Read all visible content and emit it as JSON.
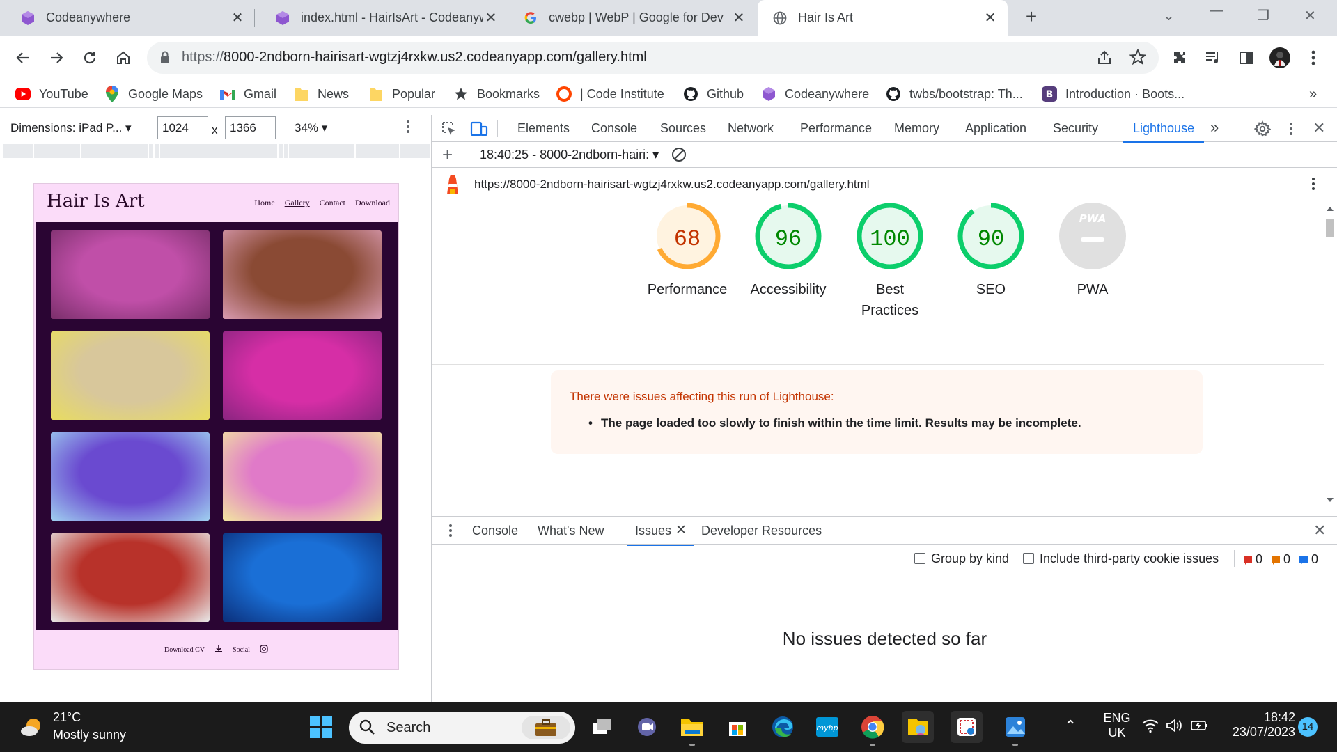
{
  "browser": {
    "tabs": [
      {
        "title": "Codeanywhere",
        "icon": "codeanywhere-icon"
      },
      {
        "title": "index.html - HairIsArt - Codeanyw",
        "icon": "codeanywhere-icon"
      },
      {
        "title": "cwebp  |  WebP  |  Google for Dev",
        "icon": "google-icon"
      },
      {
        "title": "Hair Is Art",
        "icon": "globe-icon",
        "active": true
      }
    ],
    "url": "https://8000-2ndborn-hairisart-wgtzj4rxkw.us2.codeanyapp.com/gallery.html",
    "url_prefix": "https://",
    "url_rest": "8000-2ndborn-hairisart-wgtzj4rxkw.us2.codeanyapp.com/gallery.html",
    "bookmarks": [
      {
        "label": "YouTube",
        "icon": "youtube-icon"
      },
      {
        "label": "Google Maps",
        "icon": "maps-pin-icon"
      },
      {
        "label": "Gmail",
        "icon": "gmail-icon"
      },
      {
        "label": "News",
        "icon": "folder-icon"
      },
      {
        "label": "Popular",
        "icon": "folder-icon"
      },
      {
        "label": "Bookmarks",
        "icon": "star-icon"
      },
      {
        "label": "| Code Institute",
        "icon": "code-institute-icon"
      },
      {
        "label": "Github",
        "icon": "github-icon"
      },
      {
        "label": "Codeanywhere",
        "icon": "codeanywhere-icon"
      },
      {
        "label": "twbs/bootstrap: Th...",
        "icon": "github-icon"
      },
      {
        "label": "Introduction · Boots...",
        "icon": "bootstrap-icon"
      }
    ],
    "bookmarks_overflow": "»"
  },
  "device_toolbar": {
    "dimensions_label": "Dimensions: iPad P...",
    "width": "1024",
    "times": "x",
    "height": "1366",
    "zoom": "34%"
  },
  "simulated_page": {
    "logo": "Hair Is Art",
    "nav": [
      "Home",
      "Gallery",
      "Contact",
      "Download"
    ],
    "footer_download": "Download CV",
    "footer_social": "Social",
    "photo_colors": [
      [
        "#c04fa8",
        "#7a2f6b"
      ],
      [
        "#8a4a34",
        "#d89ab0"
      ],
      [
        "#d8c79b",
        "#e8dc60"
      ],
      [
        "#d62ea6",
        "#8a2580"
      ],
      [
        "#6a4ad0",
        "#9fd0f0"
      ],
      [
        "#e07ac8",
        "#f2e6a0"
      ],
      [
        "#b8322a",
        "#e8e8e8"
      ],
      [
        "#1a6fd6",
        "#0b2f7a"
      ]
    ]
  },
  "devtools": {
    "tabs": [
      "Elements",
      "Console",
      "Sources",
      "Network",
      "Performance",
      "Memory",
      "Application",
      "Security",
      "Lighthouse"
    ],
    "active_tab": "Lighthouse",
    "report_select": "18:40:25 - 8000-2ndborn-hairi:",
    "report_url": "https://8000-2ndborn-hairisart-wgtzj4rxkw.us2.codeanyapp.com/gallery.html",
    "scores": [
      {
        "label": "Performance",
        "value": 68,
        "color": "#fa3",
        "text": "#c33300",
        "fill": "#fff3e0"
      },
      {
        "label": "Accessibility",
        "value": 96,
        "color": "#0cce6b",
        "text": "#008800",
        "fill": "#e6f9ee"
      },
      {
        "label": "Best\nPractices",
        "value": 100,
        "color": "#0cce6b",
        "text": "#008800",
        "fill": "#e6f9ee"
      },
      {
        "label": "SEO",
        "value": 90,
        "color": "#0cce6b",
        "text": "#008800",
        "fill": "#e6f9ee"
      },
      {
        "label": "PWA",
        "value": null,
        "color": "#e0e0e0",
        "text": "#9e9e9e",
        "fill": "#e0e0e0"
      }
    ],
    "pwa_badge": "PWA",
    "warning_title": "There were issues affecting this run of Lighthouse:",
    "warning_item": "The page loaded too slowly to finish within the time limit. Results may be incomplete.",
    "drawer": {
      "tabs": [
        "Console",
        "What's New",
        "Issues",
        "Developer Resources"
      ],
      "active_tab": "Issues",
      "group_by_kind": "Group by kind",
      "third_party": "Include third-party cookie issues",
      "counts": [
        "0",
        "0",
        "0"
      ],
      "empty_message": "No issues detected so far"
    }
  },
  "taskbar": {
    "weather_temp": "21°C",
    "weather_desc": "Mostly sunny",
    "search_placeholder": "Search",
    "lang1": "ENG",
    "lang2": "UK",
    "time": "18:42",
    "date": "23/07/2023",
    "notifications": "14"
  }
}
